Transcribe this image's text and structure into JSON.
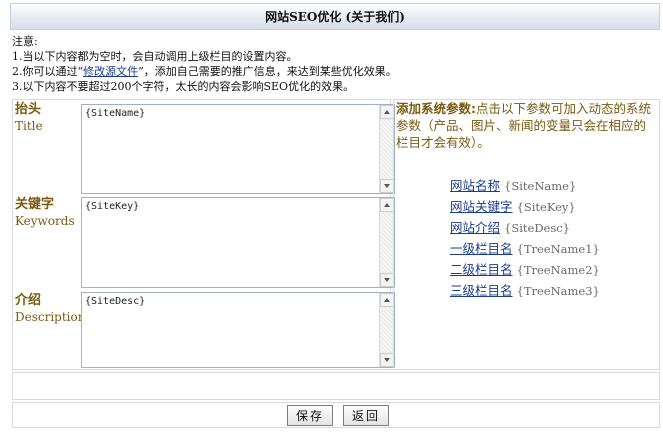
{
  "title": "网站SEO优化 (关于我们)",
  "notes": {
    "heading": "注意:",
    "line1": "1.当以下内容都为空时，会自动调用上级栏目的设置内容。",
    "line2_prefix": "2.你可以通过“",
    "line2_link": "修改源文件",
    "line2_suffix": "”，添加自己需要的推广信息，来达到某些优化效果。",
    "line3": "3.以下内容不要超过200个字符，太长的内容会影响SEO优化的效果。"
  },
  "fields": {
    "title": {
      "label_cn": "抬头",
      "label_en": "Title",
      "value": "{SiteName}"
    },
    "keywords": {
      "label_cn": "关键字",
      "label_en": "Keywords",
      "value": "{SiteKey}"
    },
    "description": {
      "label_cn": "介绍",
      "label_en": "Description",
      "value": "{SiteDesc}"
    }
  },
  "hint": {
    "bold": "添加系统参数:",
    "text": "点击以下参数可加入动态的系统参数（产品、图片、新闻的变量只会在相应的栏目才会有效）。"
  },
  "params": [
    {
      "label": "网站名称",
      "code": "{SiteName}"
    },
    {
      "label": "网站关键字",
      "code": "{SiteKey}"
    },
    {
      "label": "网站介绍",
      "code": "{SiteDesc}"
    },
    {
      "label": "一级栏目名",
      "code": "{TreeName1}"
    },
    {
      "label": "二级栏目名",
      "code": "{TreeName2}"
    },
    {
      "label": "三级栏目名",
      "code": "{TreeName3}"
    }
  ],
  "buttons": {
    "save": "保存",
    "back": "返回"
  }
}
